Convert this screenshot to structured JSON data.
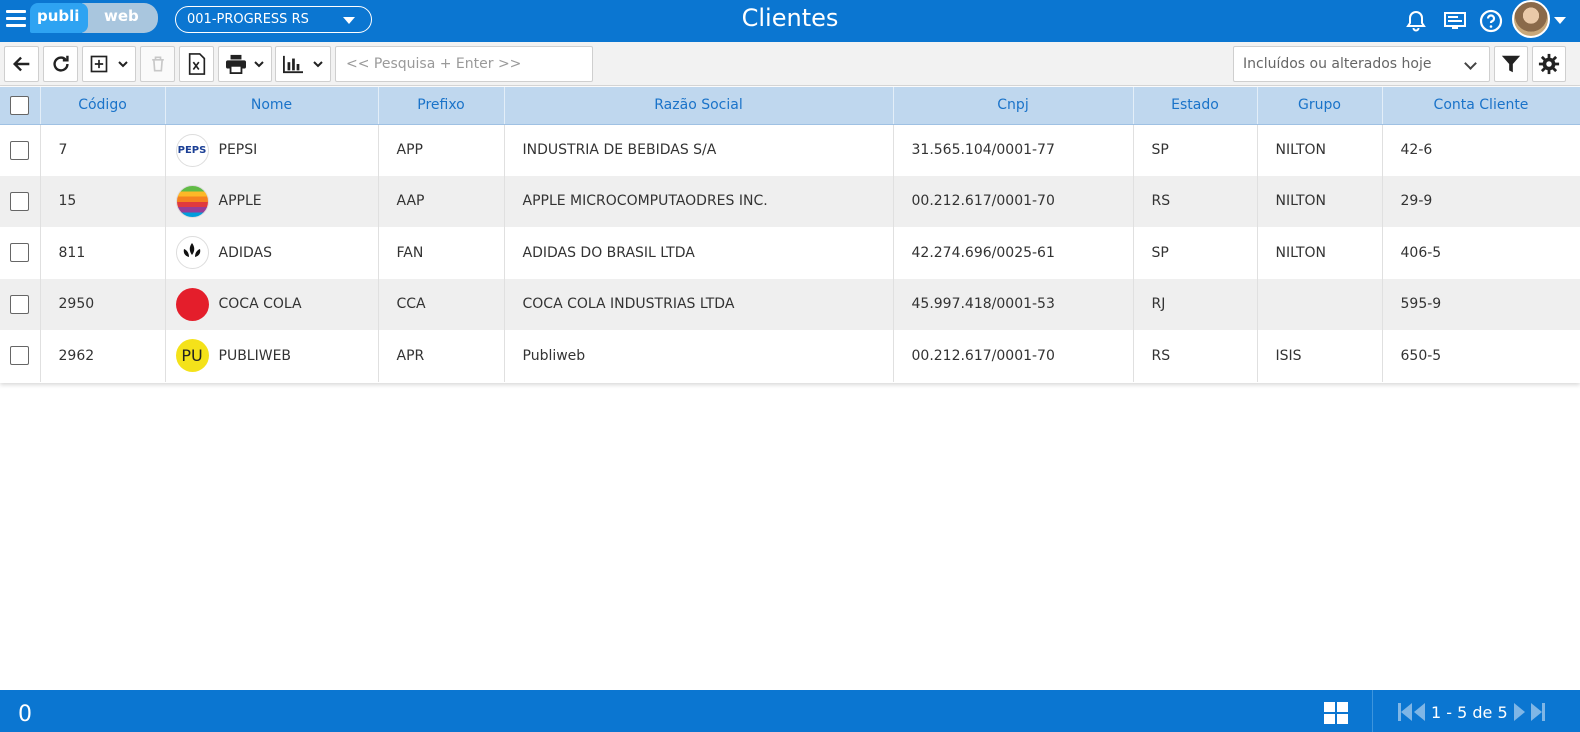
{
  "header": {
    "logo_left": "publi",
    "logo_right": "web",
    "company": "001-PROGRESS RS",
    "title": "Clientes"
  },
  "toolbar": {
    "search_placeholder": "<< Pesquisa + Enter >>",
    "filter_selected": "Incluídos ou alterados hoje"
  },
  "table": {
    "columns": [
      "Código",
      "Nome",
      "Prefixo",
      "Razão Social",
      "Cnpj",
      "Estado",
      "Grupo",
      "Conta Cliente"
    ],
    "rows": [
      {
        "codigo": "7",
        "logo": "PEPS",
        "nome": "PEPSI",
        "prefixo": "APP",
        "razao": "INDUSTRIA DE BEBIDAS S/A",
        "cnpj": "31.565.104/0001-77",
        "estado": "SP",
        "grupo": "NILTON",
        "conta": "42-6"
      },
      {
        "codigo": "15",
        "logo": "",
        "nome": "APPLE",
        "prefixo": "AAP",
        "razao": "APPLE MICROCOMPUTAODRES INC.",
        "cnpj": "00.212.617/0001-70",
        "estado": "RS",
        "grupo": "NILTON",
        "conta": "29-9"
      },
      {
        "codigo": "811",
        "logo": "adidas",
        "nome": "ADIDAS",
        "prefixo": "FAN",
        "razao": "ADIDAS DO BRASIL LTDA",
        "cnpj": "42.274.696/0025-61",
        "estado": "SP",
        "grupo": "NILTON",
        "conta": "406-5"
      },
      {
        "codigo": "2950",
        "logo": "Coca-Cola",
        "nome": "COCA COLA",
        "prefixo": "CCA",
        "razao": "COCA COLA INDUSTRIAS LTDA",
        "cnpj": "45.997.418/0001-53",
        "estado": "RJ",
        "grupo": "",
        "conta": "595-9"
      },
      {
        "codigo": "2962",
        "logo": "PU",
        "nome": "PUBLIWEB",
        "prefixo": "APR",
        "razao": "Publiweb",
        "cnpj": "00.212.617/0001-70",
        "estado": "RS",
        "grupo": "ISIS",
        "conta": "650-5"
      }
    ]
  },
  "footer": {
    "selected_count": "0",
    "pager_text": "1 - 5 de 5"
  },
  "icons": {
    "menu": "hamburger-icon",
    "notifications": "bell-icon",
    "monitor": "monitor-icon",
    "help": "help-icon",
    "back": "arrow-left-icon",
    "refresh": "refresh-icon",
    "add": "plus-square-icon",
    "delete": "trash-icon",
    "excel": "excel-icon",
    "print": "printer-icon",
    "chart": "bar-chart-icon",
    "filter": "funnel-icon",
    "settings": "gear-icon",
    "grid": "grid-view-icon"
  },
  "colors": {
    "primary": "#0b76d1",
    "header_row": "#bfd7ee",
    "header_text": "#1a73c9"
  }
}
